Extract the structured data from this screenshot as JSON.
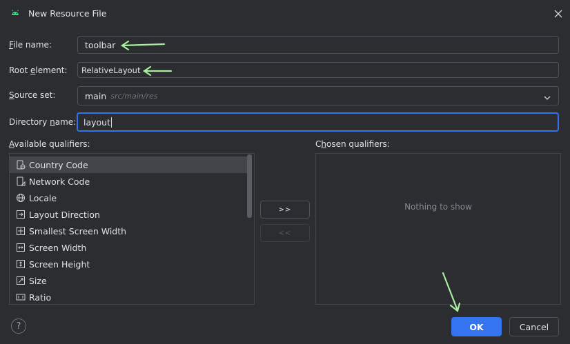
{
  "window": {
    "title": "New Resource File"
  },
  "form": {
    "file_name_label_u": "F",
    "file_name_label_rest": "ile name:",
    "file_name_value": "toolbar",
    "root_element_label_a": "Root ",
    "root_element_label_u": "e",
    "root_element_label_b": "lement:",
    "root_element_value": "RelativeLayout",
    "source_set_label_u": "S",
    "source_set_label_rest": "ource set:",
    "source_set_value": "main",
    "source_set_hint": "src/main/res",
    "directory_label_a": "Directory ",
    "directory_label_u": "n",
    "directory_label_b": "ame:",
    "directory_value": "layout"
  },
  "qualifiers": {
    "available_label_u": "A",
    "available_label_rest": "vailable qualifiers:",
    "chosen_label_a": "C",
    "chosen_label_u": "h",
    "chosen_label_b": "osen qualifiers:",
    "add_button": ">>",
    "remove_button": "<<",
    "empty_text": "Nothing to show",
    "items": [
      {
        "label": "Country Code",
        "icon": "country-code-icon"
      },
      {
        "label": "Network Code",
        "icon": "network-code-icon"
      },
      {
        "label": "Locale",
        "icon": "globe-icon"
      },
      {
        "label": "Layout Direction",
        "icon": "layout-direction-icon"
      },
      {
        "label": "Smallest Screen Width",
        "icon": "smallest-screen-width-icon"
      },
      {
        "label": "Screen Width",
        "icon": "screen-width-icon"
      },
      {
        "label": "Screen Height",
        "icon": "screen-height-icon"
      },
      {
        "label": "Size",
        "icon": "size-icon"
      },
      {
        "label": "Ratio",
        "icon": "ratio-icon"
      }
    ],
    "selected_index": 0
  },
  "footer": {
    "help": "?",
    "ok": "OK",
    "cancel": "Cancel"
  },
  "colors": {
    "background": "#2b2d30",
    "accent": "#3574f0",
    "arrow": "#a8f0a0",
    "android_green": "#3ddc84"
  }
}
